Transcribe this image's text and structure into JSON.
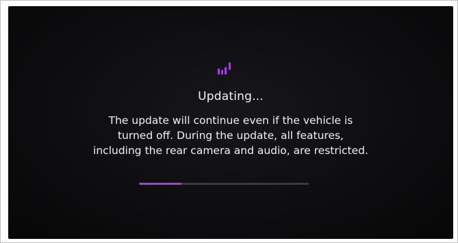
{
  "status": {
    "icon": "update-bars-icon",
    "title": "Updating...",
    "message_lines": [
      "The update will continue even if the vehicle is",
      "turned off. During the update, all features,",
      "including the rear camera and audio, are restricted."
    ]
  },
  "progress": {
    "fraction": 0.25
  },
  "colors": {
    "accent": "#a23ee6",
    "background": "#0d0d0f",
    "text": "#f2f2f2",
    "track": "#3b3b3f"
  }
}
